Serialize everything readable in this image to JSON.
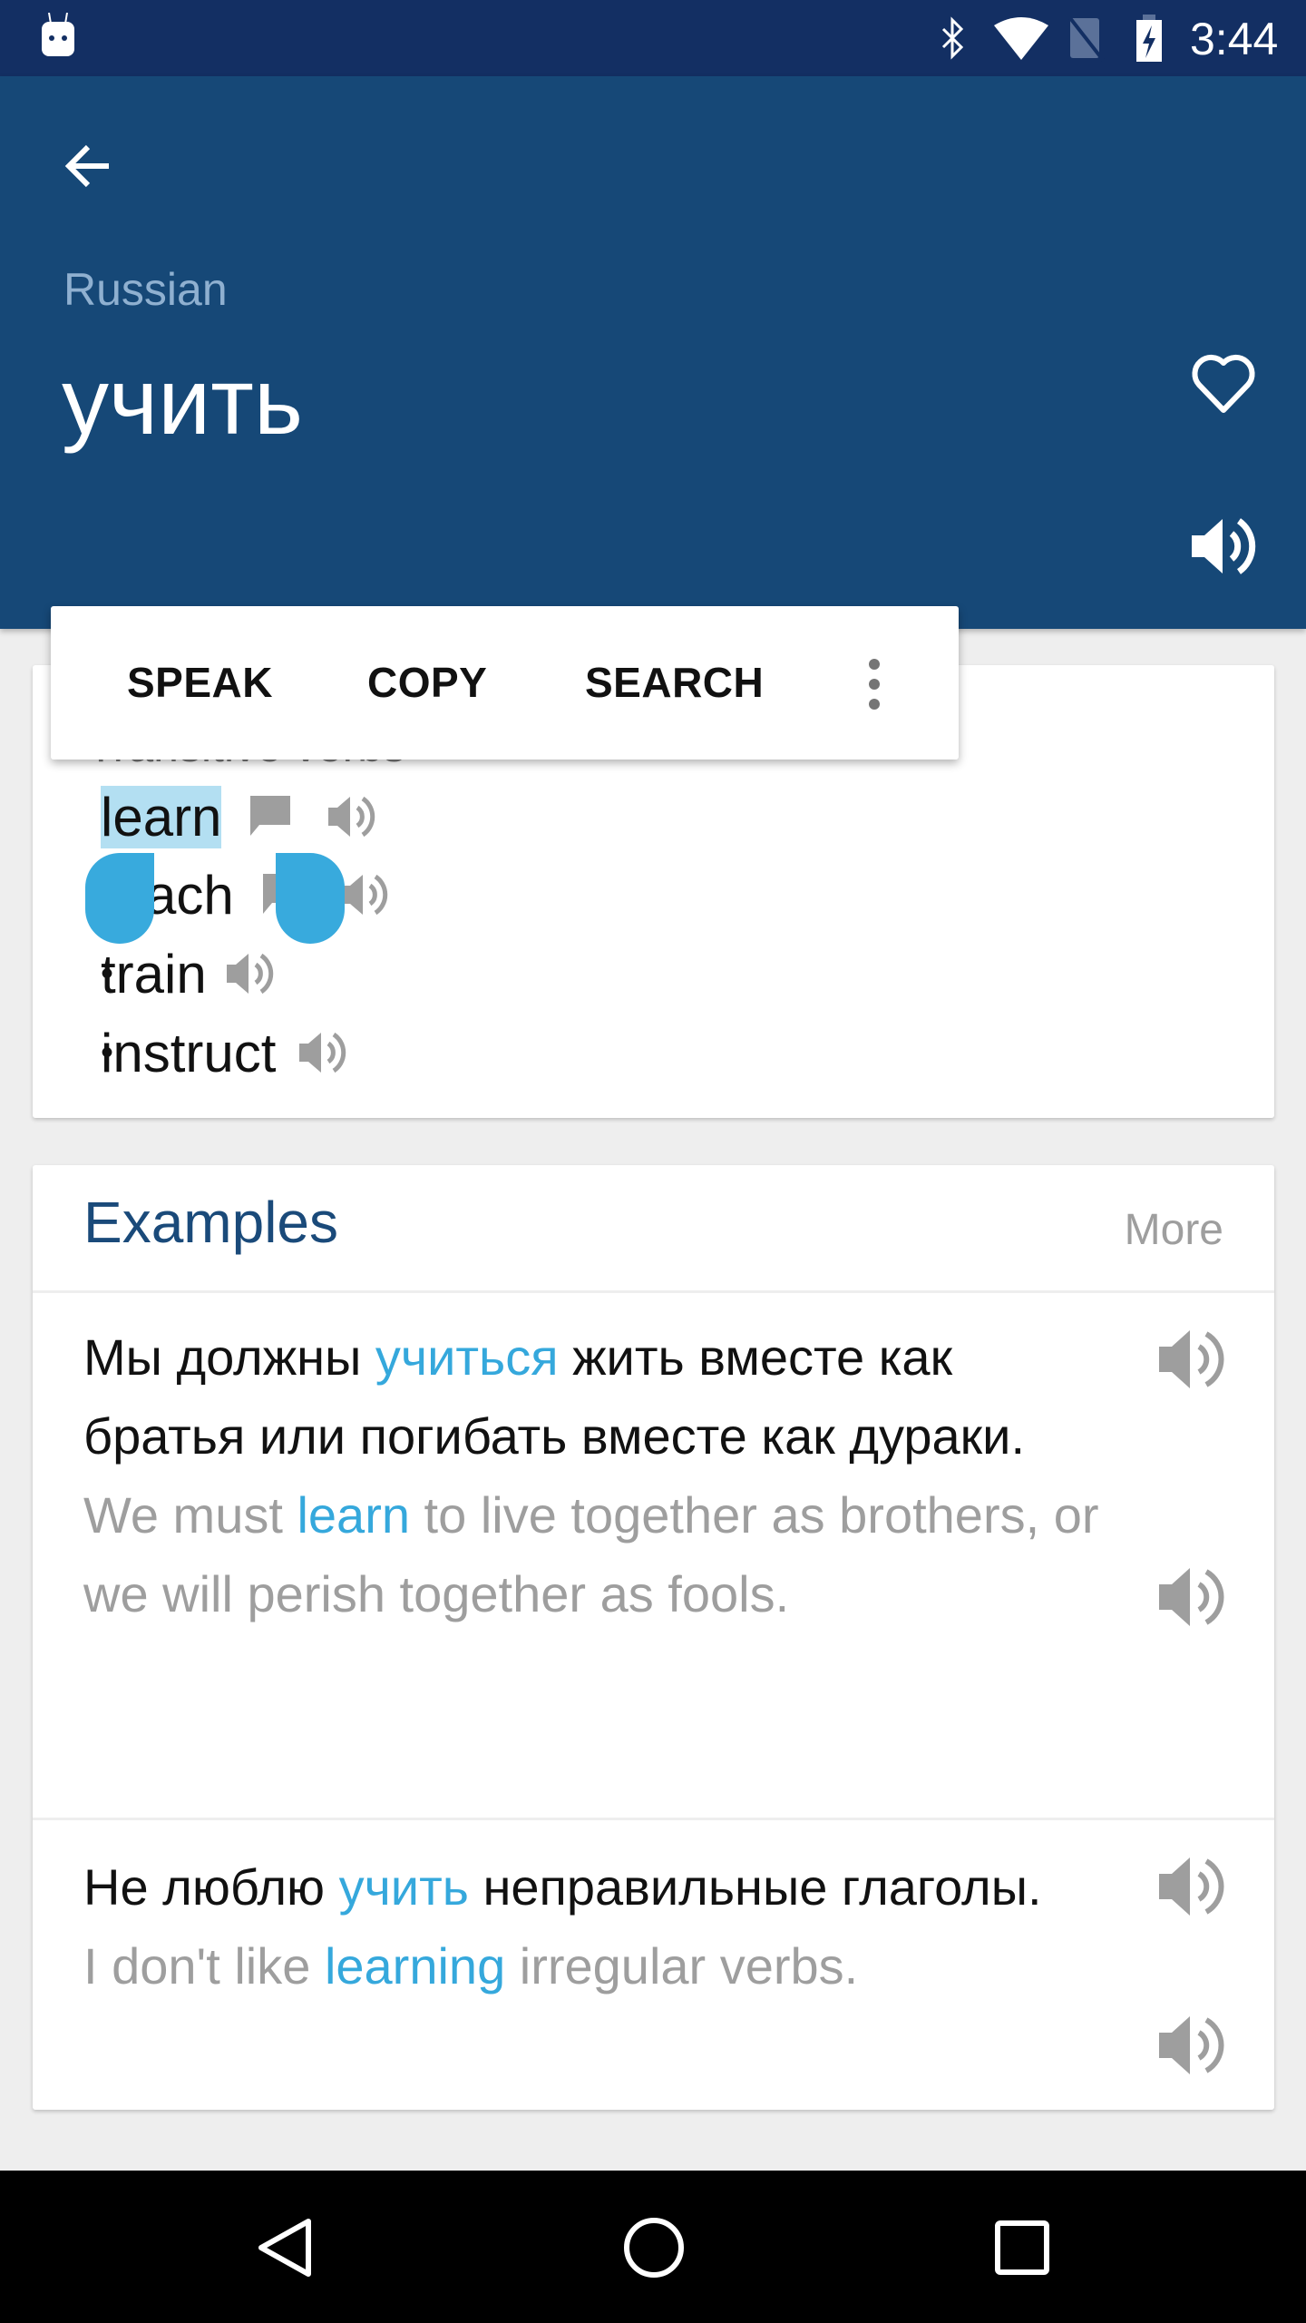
{
  "status_bar": {
    "time": "3:44",
    "icons": [
      "android-icon",
      "bluetooth-icon",
      "wifi-icon",
      "no-sim-icon",
      "battery-charging-icon"
    ]
  },
  "header": {
    "language": "Russian",
    "word": "учить",
    "icons": [
      "back-arrow-icon",
      "heart-icon",
      "speaker-icon"
    ]
  },
  "text_selection_menu": {
    "speak": "SPEAK",
    "copy": "COPY",
    "search": "SEARCH",
    "more_icon": "more-vert-icon"
  },
  "translations": {
    "heading": "Transitive verbs",
    "items": [
      {
        "word": "learn",
        "selected": true
      },
      {
        "word": "teach"
      },
      {
        "word": "train"
      },
      {
        "word": "instruct"
      }
    ]
  },
  "examples": {
    "title": "Examples",
    "more": "More",
    "items": [
      {
        "ru_before": "Мы должны ",
        "ru_hl": "учиться",
        "ru_after": " жить вместе как братья или погибать вместе как дураки.",
        "en_before": "We must ",
        "en_hl": "learn",
        "en_after": " to live together as brothers, or we will perish together as fools."
      },
      {
        "ru_before": "Не люблю ",
        "ru_hl": "учить",
        "ru_after": " неправильные глаголы.",
        "en_before": "I don't like ",
        "en_hl": "learning",
        "en_after": " irregular verbs."
      }
    ]
  },
  "colors": {
    "status_bar": "#132f63",
    "header": "#164877",
    "accent": "#35a8dc",
    "selection": "#b3dff2"
  }
}
